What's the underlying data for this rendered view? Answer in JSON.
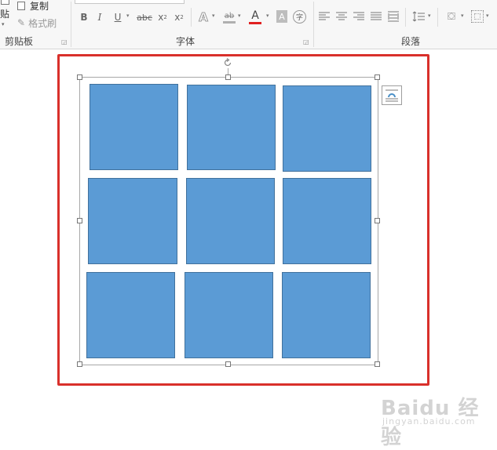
{
  "ribbon": {
    "clipboard": {
      "paste_label": "贴",
      "copy_label": "复制",
      "format_painter_label": "格式刷",
      "group_label": "剪贴板"
    },
    "font": {
      "bold": "B",
      "italic": "I",
      "underline": "U",
      "strikethrough": "abc",
      "subscript": "x",
      "subscript_mark": "2",
      "superscript": "x",
      "superscript_mark": "2",
      "text_effects": "A",
      "highlight": "ab",
      "font_color": "A",
      "char_shading": "A",
      "enclose": "字",
      "group_label": "字体",
      "font_color_hex": "#e02020",
      "highlight_hex": "#b0b0b0"
    },
    "paragraph": {
      "group_label": "段落"
    }
  },
  "document": {
    "selection_frame_color": "#d9302b",
    "cell_fill": "#5b9bd5",
    "cell_border": "#41719c",
    "grid_rows": 3,
    "grid_cols": 3
  },
  "watermark": {
    "main": "Baidu 经验",
    "sub": "jingyan.baidu.com"
  }
}
